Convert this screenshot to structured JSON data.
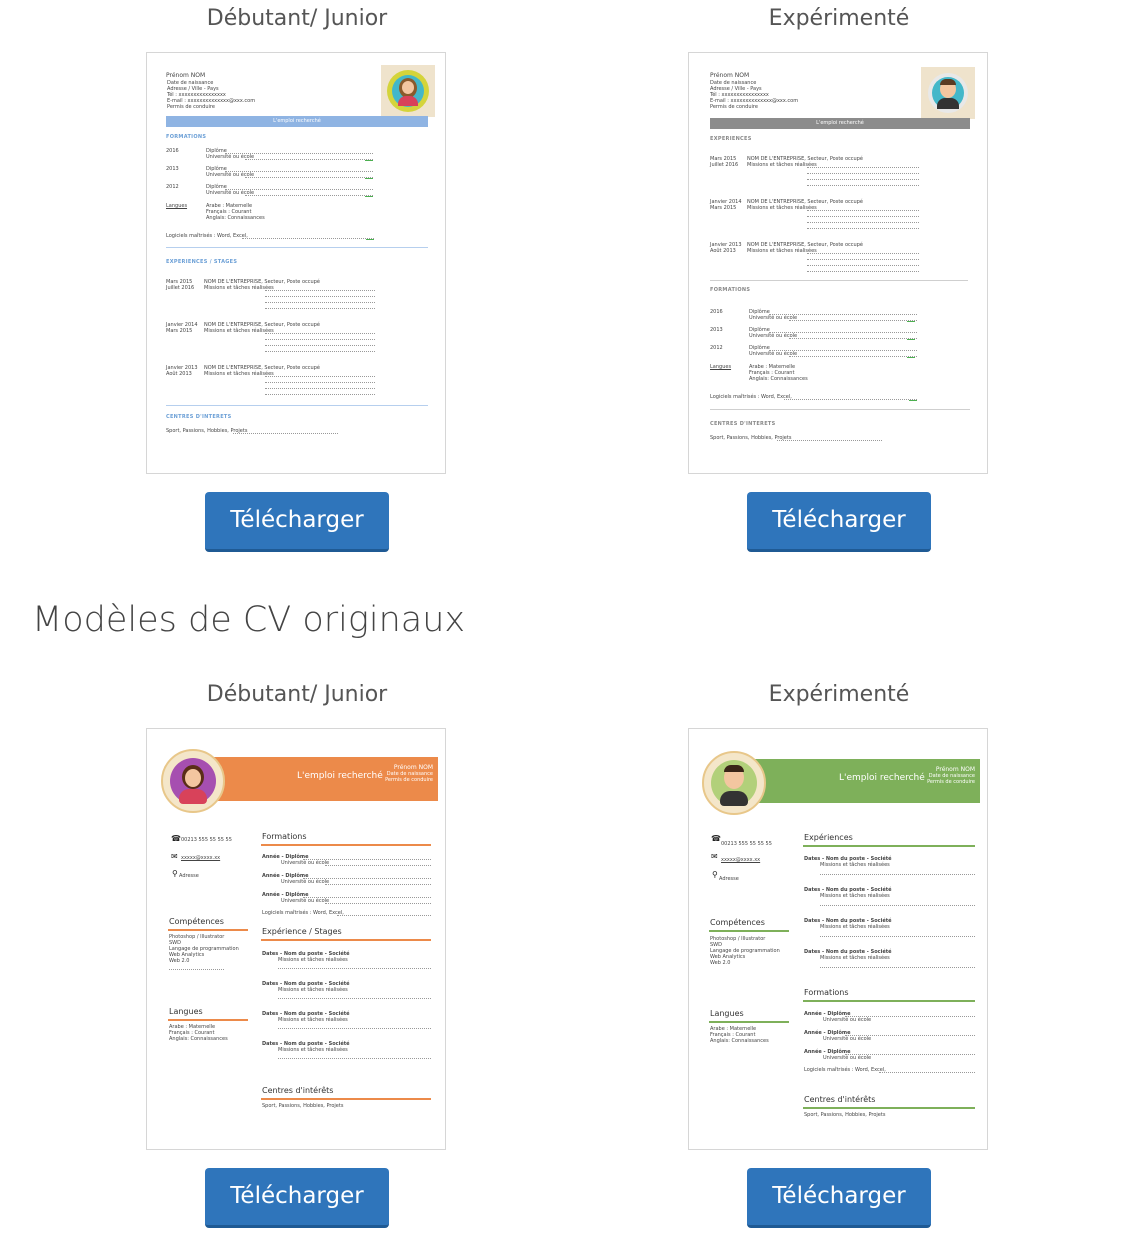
{
  "top": {
    "left_title": "Débutant/ Junior",
    "right_title": "Expérimenté",
    "download_label": "Télécharger"
  },
  "section": {
    "title": "Modèles de CV originaux"
  },
  "bottom": {
    "left_title": "Débutant/ Junior",
    "right_title": "Expérimenté",
    "download_label": "Télécharger"
  },
  "cv_classic": {
    "name": "Prénom NOM",
    "birth": "Date de naissance",
    "address": "Adresse / Ville - Pays",
    "tel": "Tél : xxxxxxxxxxxxxxxx",
    "email": "E-mail : xxxxxxxxxxxxxx@xxx.com",
    "permit": "Permis de conduire",
    "job": "L'emploi recherché",
    "formations": "FORMATIONS",
    "experiences": "EXPERIENCES / STAGES",
    "experiences_alt": "EXPERIENCES",
    "interests": "CENTRES D'INTERETS",
    "diploma": "Diplôme",
    "school": "Université ou école",
    "years": [
      "2016",
      "2013",
      "2012"
    ],
    "languages": "Langues",
    "lang_lines": [
      "Arabe : Maternelle",
      "Français : Courant",
      "Anglais: Connaissances"
    ],
    "software": "Logiciels maîtrisés : Word, Excel,",
    "company": "NOM DE L'ENTREPRISE, Secteur, Poste occupé",
    "missions": "Missions et tâches réalisées",
    "dates": [
      [
        "Mars 2015",
        "Juillet 2016"
      ],
      [
        "Janvier 2014",
        "Mars 2015"
      ],
      [
        "Janvier 2013",
        "Août 2013"
      ]
    ],
    "interests_line": "Sport, Passions, Hobbies, Projets"
  },
  "cv_original": {
    "job": "L'emploi recherché",
    "name": "Prénom NOM",
    "birth": "Date de naissance",
    "permit": "Permis de conduire",
    "phone": "00213 555 55 55 55",
    "email": "xxxxx@xxxx.xx",
    "address": "Adresse",
    "skills": "Compétences",
    "skill_lines": [
      "Photoshop / Illustrator",
      "SWD",
      "Langage de programmation",
      "Web Analytics",
      "Web 2.0"
    ],
    "languages": "Langues",
    "lang_lines": [
      "Arabe : Maternelle",
      "Français : Courant",
      "Anglais: Connaissances"
    ],
    "formations": "Formations",
    "experience_stages": "Expérience / Stages",
    "experiences": "Expériences",
    "interests": "Centres d'intérêts",
    "year_diploma": "Année - Diplôme",
    "school": "Université ou école",
    "software": "Logiciels maîtrisés : Word, Excel,",
    "job_line": "Dates - Nom du poste - Société",
    "missions": "Missions et tâches réalisées",
    "interests_line": "Sport, Passions, Hobbies, Projets"
  },
  "colors": {
    "button": "#2f75bb",
    "orange": "#ec8a4a",
    "green": "#7eb05a",
    "blue_bar": "#8fb4e3",
    "grey_bar": "#8c8c8c"
  }
}
